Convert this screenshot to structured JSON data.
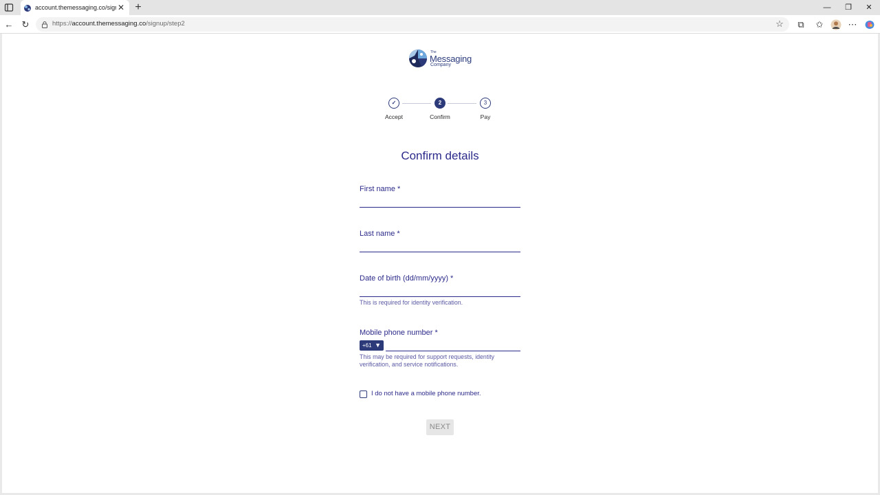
{
  "browser": {
    "tab_title": "account.themessaging.co/signup/step2",
    "url_prefix": "https://",
    "url_host": "account.themessaging.co",
    "url_path": "/signup/step2",
    "new_tab_glyph": "+",
    "tab_close_glyph": "✕",
    "controls": {
      "minimize": "—",
      "maximize": "❐",
      "close": "✕"
    },
    "toolbar_glyphs": {
      "back": "←",
      "reload": "↻",
      "star": "☆",
      "extensions": "⧉",
      "favorites": "✩",
      "more": "⋯"
    }
  },
  "logo": {
    "line1": "The",
    "line2": "Messaging",
    "line3": "Company"
  },
  "stepper": {
    "steps": [
      {
        "label": "Accept",
        "marker": "✓",
        "state": "done"
      },
      {
        "label": "Confirm",
        "marker": "2",
        "state": "active"
      },
      {
        "label": "Pay",
        "marker": "3",
        "state": "todo"
      }
    ]
  },
  "form": {
    "title": "Confirm details",
    "first_name": {
      "label": "First name *",
      "value": ""
    },
    "last_name": {
      "label": "Last name *",
      "value": ""
    },
    "dob": {
      "label": "Date of birth (dd/mm/yyyy) *",
      "value": "",
      "help": "This is required for identity verification."
    },
    "mobile": {
      "label": "Mobile phone number *",
      "country_code": "+61",
      "dropdown_glyph": "▼",
      "value": "",
      "help": "This may be required for support requests, identity verification, and service notifications."
    },
    "no_mobile_checkbox": {
      "label": "I do not have a mobile phone number.",
      "checked": false
    },
    "next_button": "NEXT"
  },
  "colors": {
    "primary": "#2d3a7a",
    "text": "#2b2a8a",
    "help": "#5a59a3",
    "button_disabled_bg": "#e6e6e6"
  }
}
